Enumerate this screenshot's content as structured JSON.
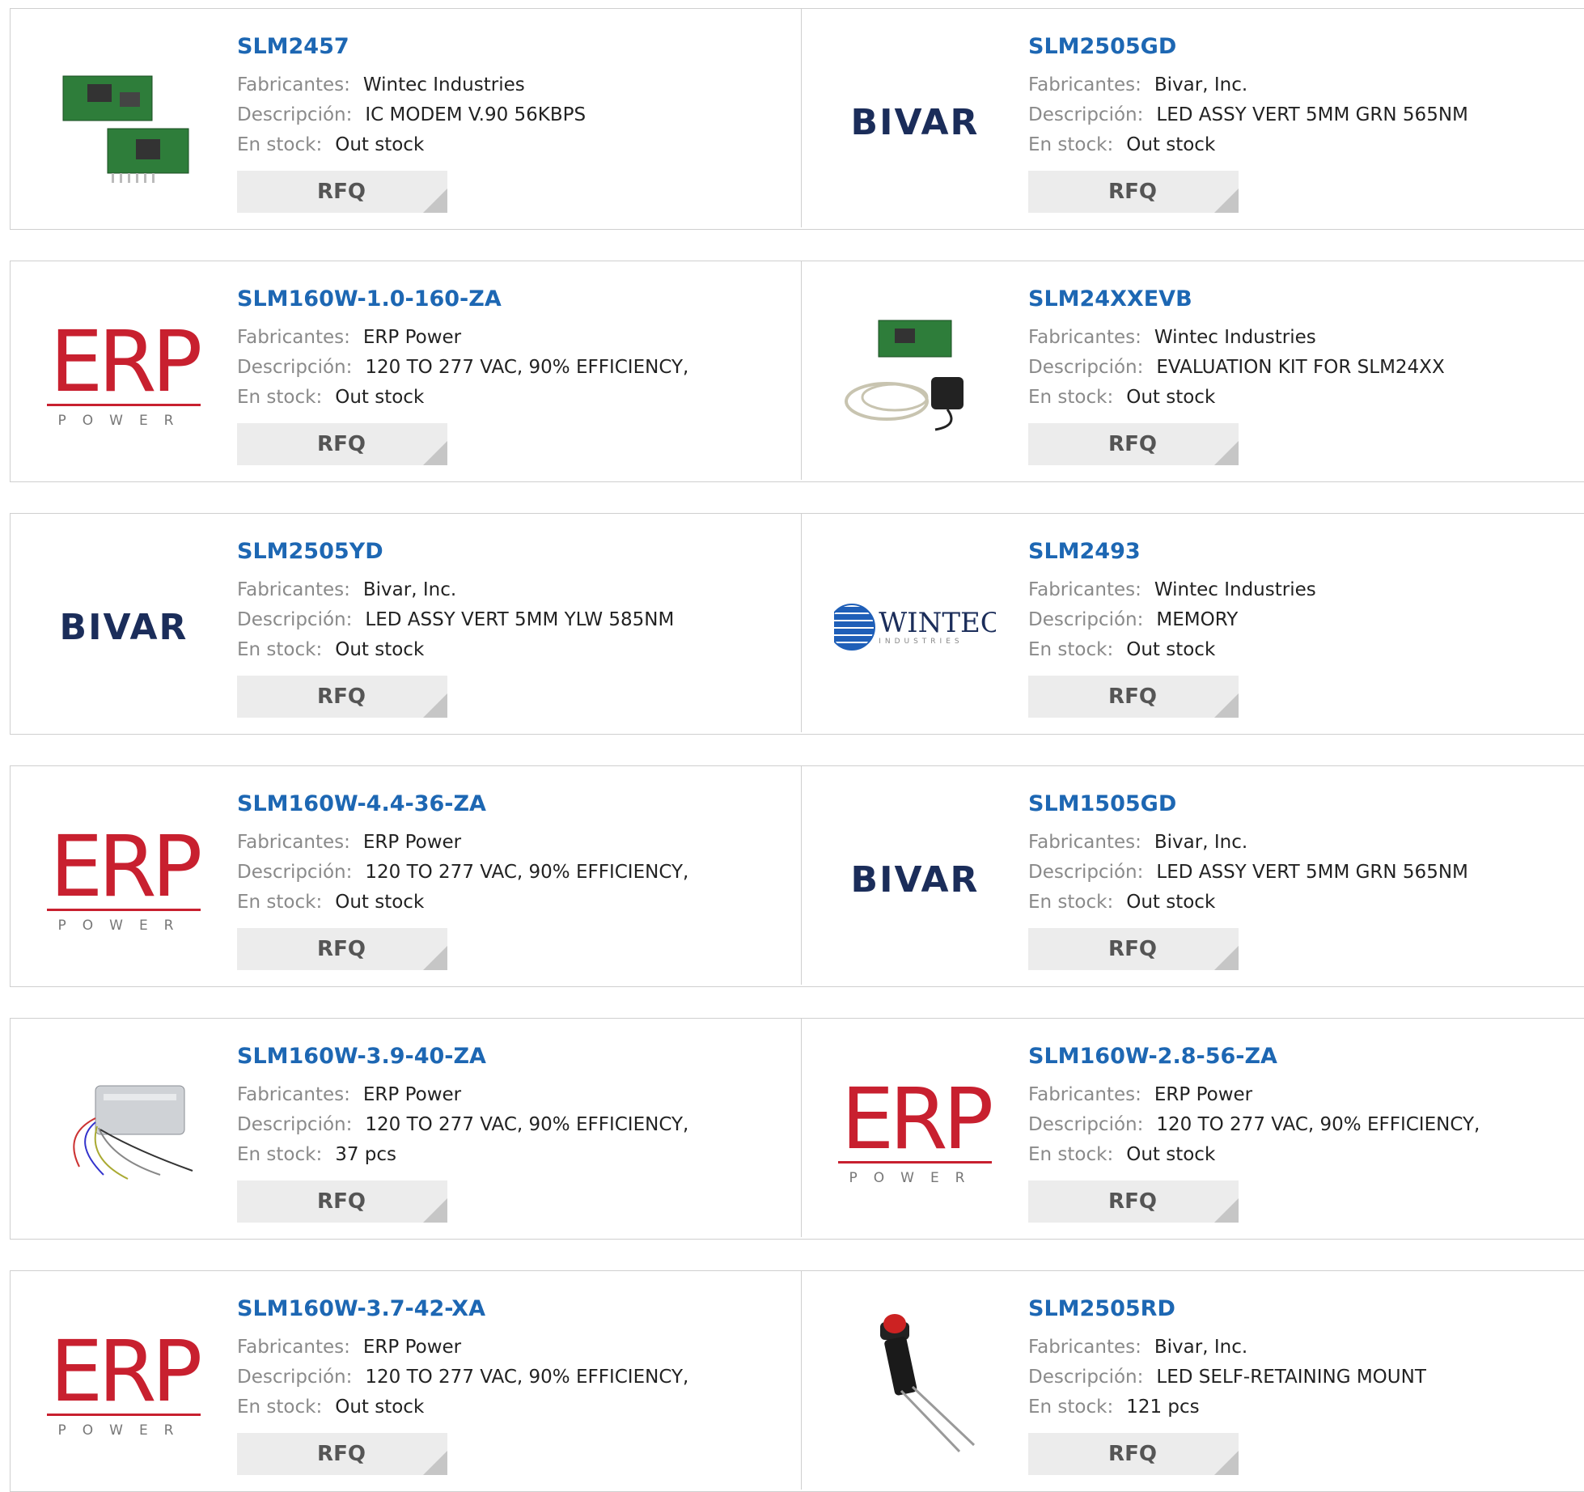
{
  "labels": {
    "manufacturer": "Fabricantes:",
    "description": "Descripción:",
    "stock": "En stock:",
    "rfq": "RFQ"
  },
  "logos": {
    "bivar": "BIVAR",
    "erp_big": "ERP",
    "erp_sub": "POWER",
    "wintec": "WINTEC",
    "wintec_sub": "INDUSTRIES"
  },
  "colors": {
    "link": "#1d67b3",
    "label": "#8a8a8a",
    "button_bg": "#ececec",
    "erp_red": "#c8202f",
    "bivar_navy": "#1b2d5a"
  },
  "products": [
    {
      "pn": "SLM2457",
      "manufacturer": "Wintec Industries",
      "description": "IC MODEM V.90 56KBPS",
      "stock": "Out stock",
      "image": "modem-board-photo"
    },
    {
      "pn": "SLM2505GD",
      "manufacturer": "Bivar, Inc.",
      "description": "LED ASSY VERT 5MM GRN 565NM",
      "stock": "Out stock",
      "image": "bivar-logo"
    },
    {
      "pn": "SLM160W-1.0-160-ZA",
      "manufacturer": "ERP Power",
      "description": "120 TO 277 VAC, 90% EFFICIENCY,",
      "stock": "Out stock",
      "image": "erp-logo"
    },
    {
      "pn": "SLM24XXEVB",
      "manufacturer": "Wintec Industries",
      "description": "EVALUATION KIT FOR SLM24XX",
      "stock": "Out stock",
      "image": "evaluation-kit-photo"
    },
    {
      "pn": "SLM2505YD",
      "manufacturer": "Bivar, Inc.",
      "description": "LED ASSY VERT 5MM YLW 585NM",
      "stock": "Out stock",
      "image": "bivar-logo"
    },
    {
      "pn": "SLM2493",
      "manufacturer": "Wintec Industries",
      "description": "MEMORY",
      "stock": "Out stock",
      "image": "wintec-logo"
    },
    {
      "pn": "SLM160W-4.4-36-ZA",
      "manufacturer": "ERP Power",
      "description": "120 TO 277 VAC, 90% EFFICIENCY,",
      "stock": "Out stock",
      "image": "erp-logo"
    },
    {
      "pn": "SLM1505GD",
      "manufacturer": "Bivar, Inc.",
      "description": "LED ASSY VERT 5MM GRN 565NM",
      "stock": "Out stock",
      "image": "bivar-logo"
    },
    {
      "pn": "SLM160W-3.9-40-ZA",
      "manufacturer": "ERP Power",
      "description": "120 TO 277 VAC, 90% EFFICIENCY,",
      "stock": "37 pcs",
      "image": "led-driver-photo"
    },
    {
      "pn": "SLM160W-2.8-56-ZA",
      "manufacturer": "ERP Power",
      "description": "120 TO 277 VAC, 90% EFFICIENCY,",
      "stock": "Out stock",
      "image": "erp-logo"
    },
    {
      "pn": "SLM160W-3.7-42-XA",
      "manufacturer": "ERP Power",
      "description": "120 TO 277 VAC, 90% EFFICIENCY,",
      "stock": "Out stock",
      "image": "erp-logo"
    },
    {
      "pn": "SLM2505RD",
      "manufacturer": "Bivar, Inc.",
      "description": "LED SELF-RETAINING MOUNT",
      "stock": "121 pcs",
      "image": "red-led-photo"
    }
  ]
}
